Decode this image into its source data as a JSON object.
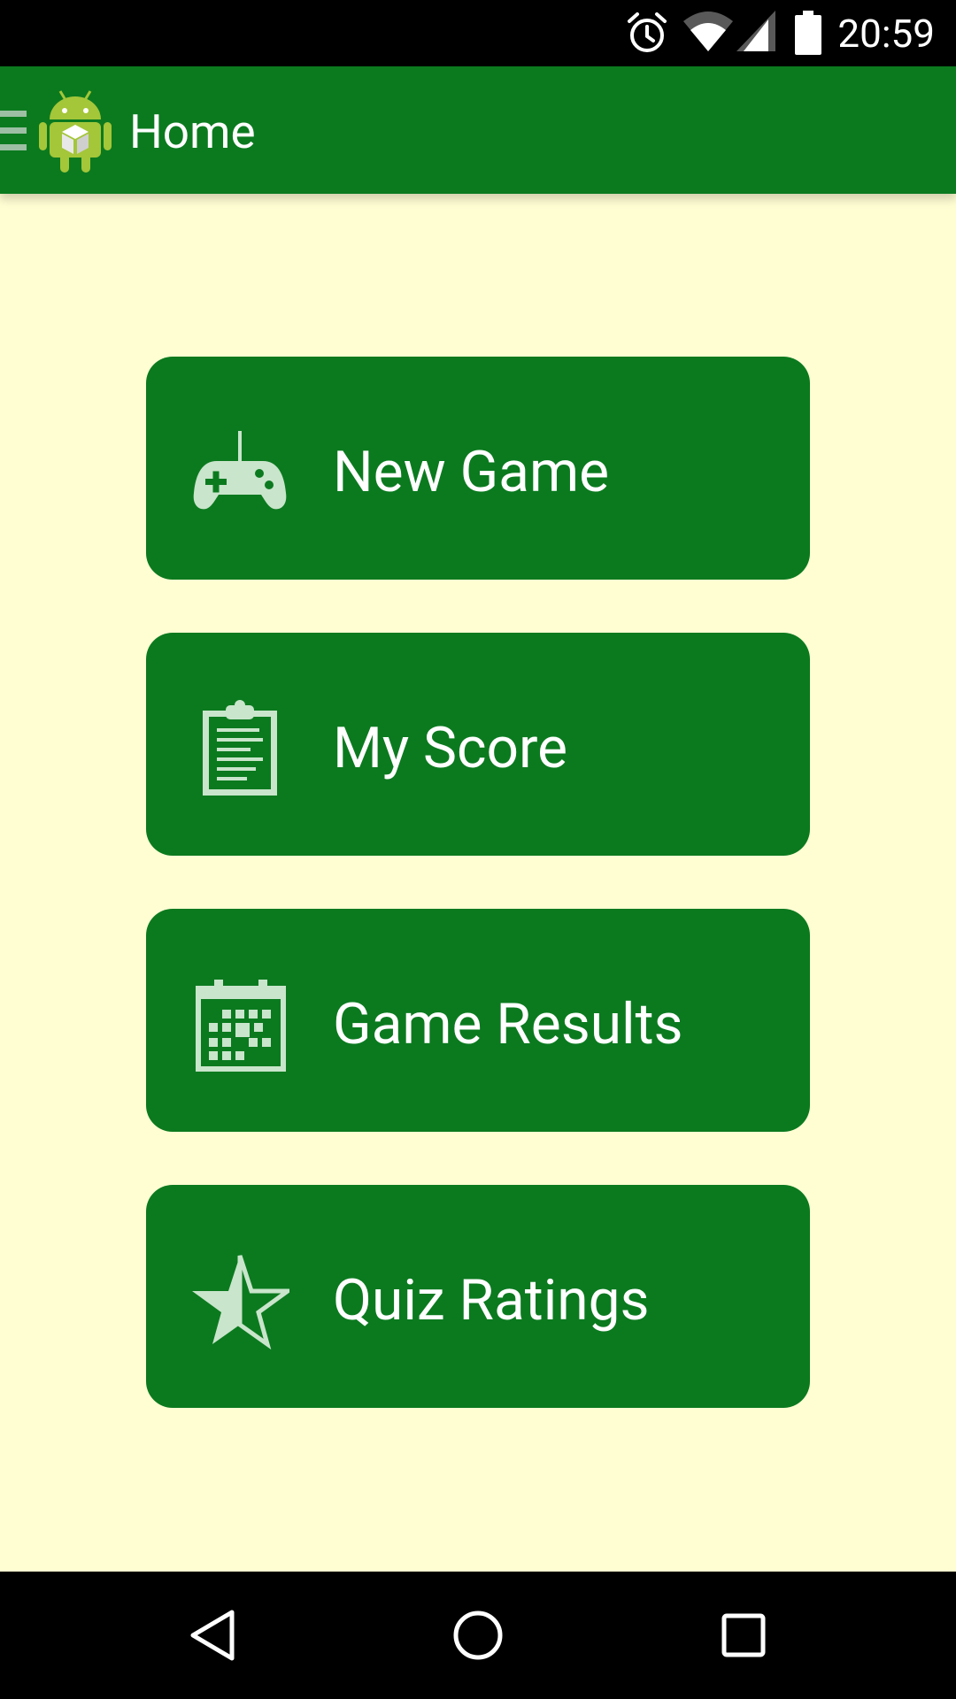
{
  "status_bar": {
    "time": "20:59",
    "icons": [
      "alarm-icon",
      "wifi-icon",
      "cell-signal-icon",
      "battery-icon"
    ]
  },
  "app_bar": {
    "title": "Home",
    "menu_icon": "hamburger-icon",
    "logo_icon": "android-robot-logo"
  },
  "menu": [
    {
      "label": "New Game",
      "icon": "gamepad-icon"
    },
    {
      "label": "My Score",
      "icon": "clipboard-icon"
    },
    {
      "label": "Game Results",
      "icon": "calendar-icon"
    },
    {
      "label": "Quiz Ratings",
      "icon": "half-star-icon"
    }
  ],
  "nav_bar": {
    "icons": [
      "back-icon",
      "home-icon",
      "recents-icon"
    ]
  },
  "colors": {
    "primary": "#0B7A1F",
    "background": "#FFFDD2",
    "icon_tint": "#C9E5CB",
    "text": "#FFFFFF"
  }
}
